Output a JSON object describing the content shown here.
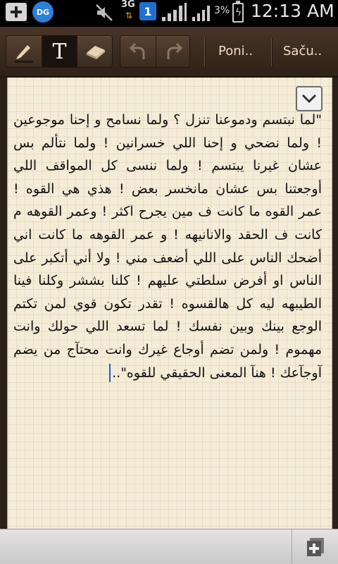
{
  "status_bar": {
    "app_badge": "DG",
    "network": "3G",
    "network_arrows": "⇅",
    "sim": "1",
    "battery_percent": "3%",
    "time": "12:13 AM"
  },
  "toolbar": {
    "pen_icon": "pen-icon",
    "text_tool": "T",
    "eraser_icon": "eraser-icon",
    "undo_icon": "undo-icon",
    "redo_icon": "redo-icon",
    "poni_label": "Poni..",
    "sacu_label": "Saču.."
  },
  "note": {
    "text": "\"لما نبتسم ودموعنا تنزل ؟ ولما نسامح و إحنا موجوعين ! ولما نضحي و إحنا اللي خسرانين ! ولما نتألم بس عشان غيرنا يبتسم ! ولما ننسى كل المواقف اللي أوجعتنا بس عشان مانخسر بعض ! هذي هي القوه ! عمر القوه ما كانت ف مين يجرح اكثر ! وعمر القوهه م كانت ف الحقد والانانيهه ! و عمر القوهه ما كانت اني أضحك الناس على اللي أضعف مني ! ولا أني أتكبر على الناس او أفرض سلطتي عليهم ! كلنا بششر وكلنا فينا الطيبهه ليه كل هالقسوه ! تقدر تكون قوي لمن تكتم الوجع بينك وبين نفسك ! لما تسعد اللي حولك وانت مهموم ! ولمن تضم أوجاع غيرك وانت محتآج من يضم آوجآعك ! هنآ المعنى الحقيقي للقوه\".."
  },
  "colors": {
    "toolbar": "#3a2a1f",
    "paper": "#f5ecd8",
    "caret": "#1e5bd8"
  }
}
